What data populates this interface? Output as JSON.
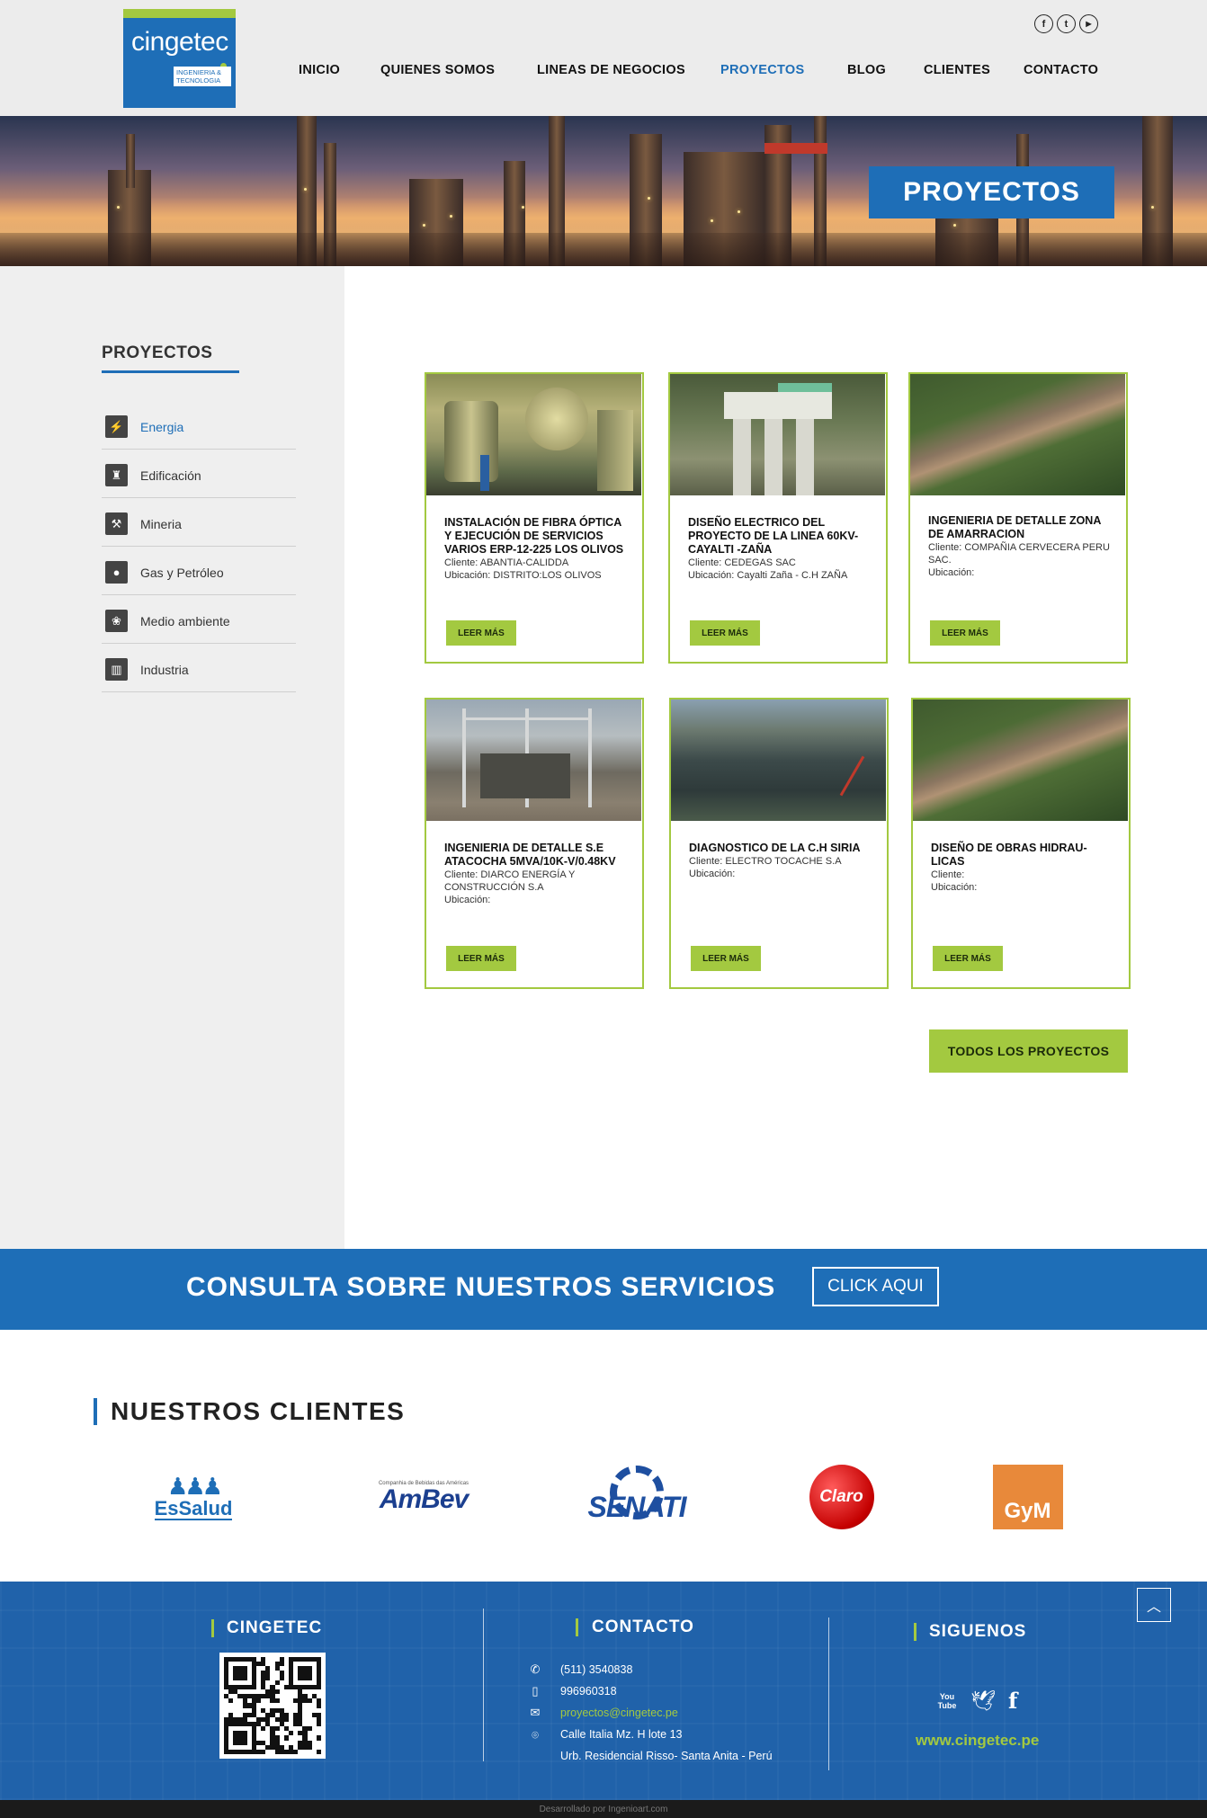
{
  "header": {
    "logo_name": "cingetec",
    "logo_sub": "INGENIERIA & TECNOLOGIA",
    "social": [
      {
        "icon": "facebook-icon",
        "glyph": "f"
      },
      {
        "icon": "twitter-icon",
        "glyph": "t"
      },
      {
        "icon": "youtube-icon",
        "glyph": "▶"
      }
    ],
    "nav": [
      {
        "label": "INICIO",
        "active": false
      },
      {
        "label": "QUIENES SOMOS",
        "active": false
      },
      {
        "label": "LINEAS DE NEGOCIOS",
        "active": false
      },
      {
        "label": "PROYECTOS",
        "active": true
      },
      {
        "label": "BLOG",
        "active": false
      },
      {
        "label": "CLIENTES",
        "active": false
      },
      {
        "label": "CONTACTO",
        "active": false
      }
    ]
  },
  "hero": {
    "title": "PROYECTOS"
  },
  "sidebar": {
    "title": "PROYECTOS",
    "items": [
      {
        "label": "Energia",
        "icon": "lightning-icon",
        "glyph": "⚡",
        "active": true
      },
      {
        "label": "Edificación",
        "icon": "tower-icon",
        "glyph": "♜",
        "active": false
      },
      {
        "label": "Mineria",
        "icon": "mining-icon",
        "glyph": "⚒",
        "active": false
      },
      {
        "label": "Gas y Petróleo",
        "icon": "drop-icon",
        "glyph": "●",
        "active": false
      },
      {
        "label": "Medio ambiente",
        "icon": "environment-icon",
        "glyph": "❀",
        "active": false
      },
      {
        "label": "Industria",
        "icon": "factory-icon",
        "glyph": "▥",
        "active": false
      }
    ]
  },
  "projects": [
    {
      "title": "INSTALACIÓN DE FIBRA ÓPTICA  Y EJECUCIÓN DE SERVICIOS VARIOS ERP-12-225 LOS OLIVOS",
      "client": "Cliente: ABANTIA-CALIDDA",
      "location": "Ubicación: DISTRITO:LOS OLIVOS",
      "button": "LEER MÁS"
    },
    {
      "title": "DISEÑO ELECTRICO DEL PROYECTO DE LA LINEA 60KV- CAYALTI -ZAÑA",
      "client": "Cliente: CEDEGAS SAC",
      "location": "Ubicación: Cayalti Zaña - C.H ZAÑA",
      "button": "LEER MÁS"
    },
    {
      "title": "INGENIERIA DE DETALLE ZONA DE AMARRACION",
      "client": "Cliente: COMPAÑIA CERVECERA PERU SAC.",
      "location": "Ubicación:",
      "button": "LEER MÁS"
    },
    {
      "title": "INGENIERIA DE DETALLE S.E ATACOCHA 5MVA/10K-V/0.48KV",
      "client": "Cliente: DIARCO ENERGÍA Y CONSTRUCCIÓN S.A",
      "location": "Ubicación:",
      "button": "LEER MÁS"
    },
    {
      "title": "DIAGNOSTICO DE LA C.H SIRIA",
      "client": "Cliente: ELECTRO TOCACHE S.A",
      "location": "Ubicación:",
      "button": "LEER MÁS"
    },
    {
      "title": "DISEÑO DE OBRAS HIDRAU-LICAS",
      "client": "Cliente:",
      "location": "Ubicación:",
      "button": "LEER MÁS"
    }
  ],
  "all_projects_button": "TODOS LOS PROYECTOS",
  "cta": {
    "text": "CONSULTA SOBRE NUESTROS SERVICIOS",
    "button": "CLICK AQUI"
  },
  "clients": {
    "title": "NUESTROS CLIENTES",
    "logos": [
      {
        "name": "EsSalud",
        "small": ""
      },
      {
        "name": "AmBev",
        "small": "Companhia de Bebidas das Américas"
      },
      {
        "name": "SENATI",
        "small": ""
      },
      {
        "name": "Claro",
        "small": ""
      },
      {
        "name": "GyM",
        "small": ""
      }
    ]
  },
  "footer": {
    "col1_title": "CINGETEC",
    "col2_title": "CONTACTO",
    "col3_title": "SIGUENOS",
    "phone": "(511) 3540838",
    "mobile": "996960318",
    "email": "proyectos@cingetec.pe",
    "address1": "Calle Italia Mz. H lote 13",
    "address2": "Urb. Residencial Risso- Santa Anita - Perú",
    "website": "www.cingetec.pe",
    "social": [
      {
        "icon": "youtube-icon",
        "glyph": "You Tube"
      },
      {
        "icon": "twitter-icon",
        "glyph": "🐦"
      },
      {
        "icon": "facebook-icon",
        "glyph": "f"
      }
    ],
    "credit": "Desarrollado por Ingenioart.com"
  },
  "colors": {
    "blue": "#1e6eb7",
    "green": "#a3c940",
    "footer_blue": "#2062aa"
  }
}
